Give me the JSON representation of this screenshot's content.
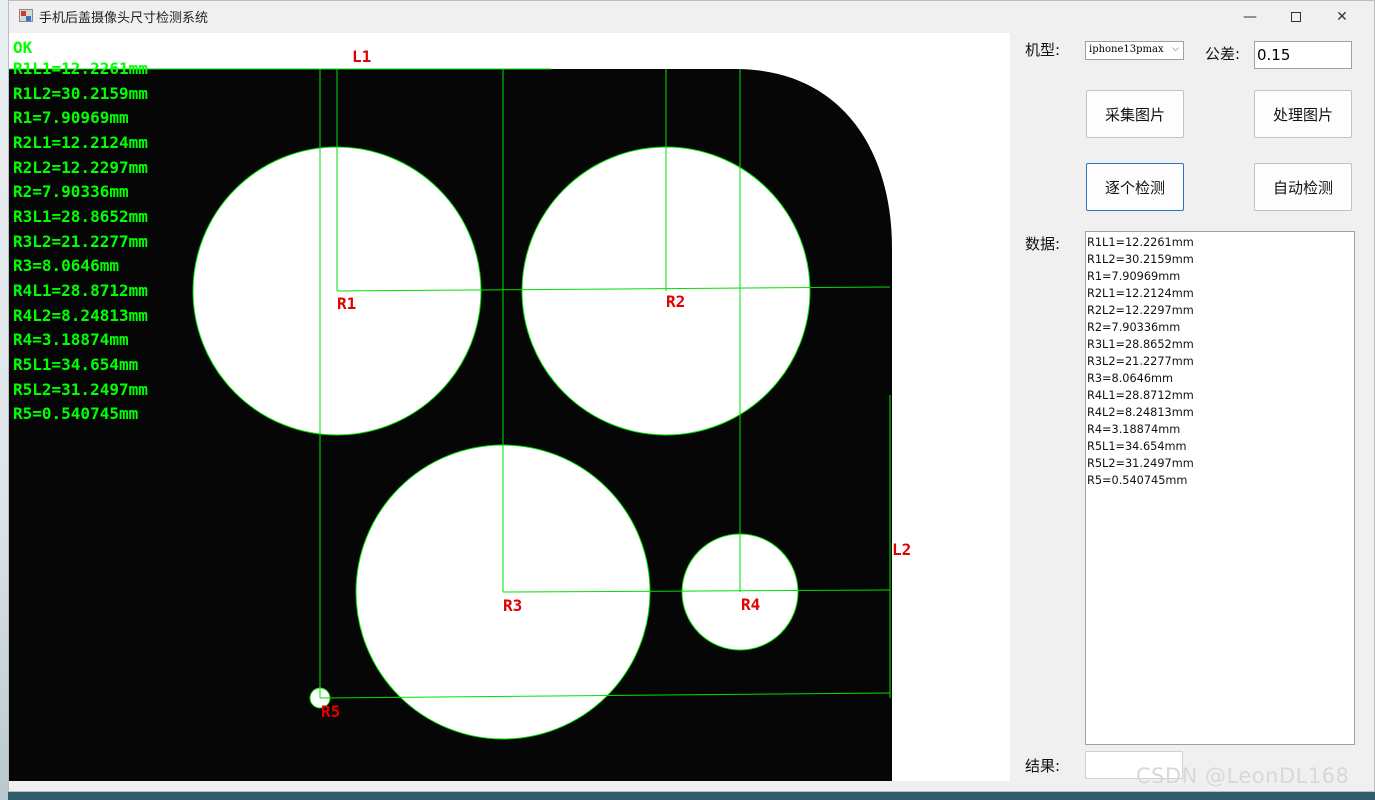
{
  "window": {
    "title": "手机后盖摄像头尺寸检测系统"
  },
  "overlay": {
    "status": "OK",
    "lines": [
      "R1L1=12.2261mm",
      "R1L2=30.2159mm",
      "R1=7.90969mm",
      "R2L1=12.2124mm",
      "R2L2=12.2297mm",
      "R2=7.90336mm",
      "R3L1=28.8652mm",
      "R3L2=21.2277mm",
      "R3=8.0646mm",
      "R4L1=28.8712mm",
      "R4L2=8.24813mm",
      "R4=3.18874mm",
      "R5L1=34.654mm",
      "R5L2=31.2497mm",
      "R5=0.540745mm"
    ],
    "labels": {
      "l1": "L1",
      "l2": "L2",
      "r1": "R1",
      "r2": "R2",
      "r3": "R3",
      "r4": "R4",
      "r5": "R5"
    },
    "colors": {
      "text_green": "#00ff00",
      "line_green": "#00e000",
      "label_red": "#e00000"
    }
  },
  "controls": {
    "model_label": "机型:",
    "model_value": "iphone13pmax",
    "tolerance_label": "公差:",
    "tolerance_value": "0.15",
    "capture_button": "采集图片",
    "process_button": "处理图片",
    "step_detect_button": "逐个检测",
    "auto_detect_button": "自动检测",
    "data_label": "数据:",
    "result_label": "结果:",
    "result_value": ""
  },
  "data_list": [
    "R1L1=12.2261mm",
    "R1L2=30.2159mm",
    "R1=7.90969mm",
    "R2L1=12.2124mm",
    "R2L2=12.2297mm",
    "R2=7.90336mm",
    "R3L1=28.8652mm",
    "R3L2=21.2277mm",
    "R3=8.0646mm",
    "R4L1=28.8712mm",
    "R4L2=8.24813mm",
    "R4=3.18874mm",
    "R5L1=34.654mm",
    "R5L2=31.2497mm",
    "R5=0.540745mm"
  ],
  "watermark": "CSDN @LeonDL168"
}
